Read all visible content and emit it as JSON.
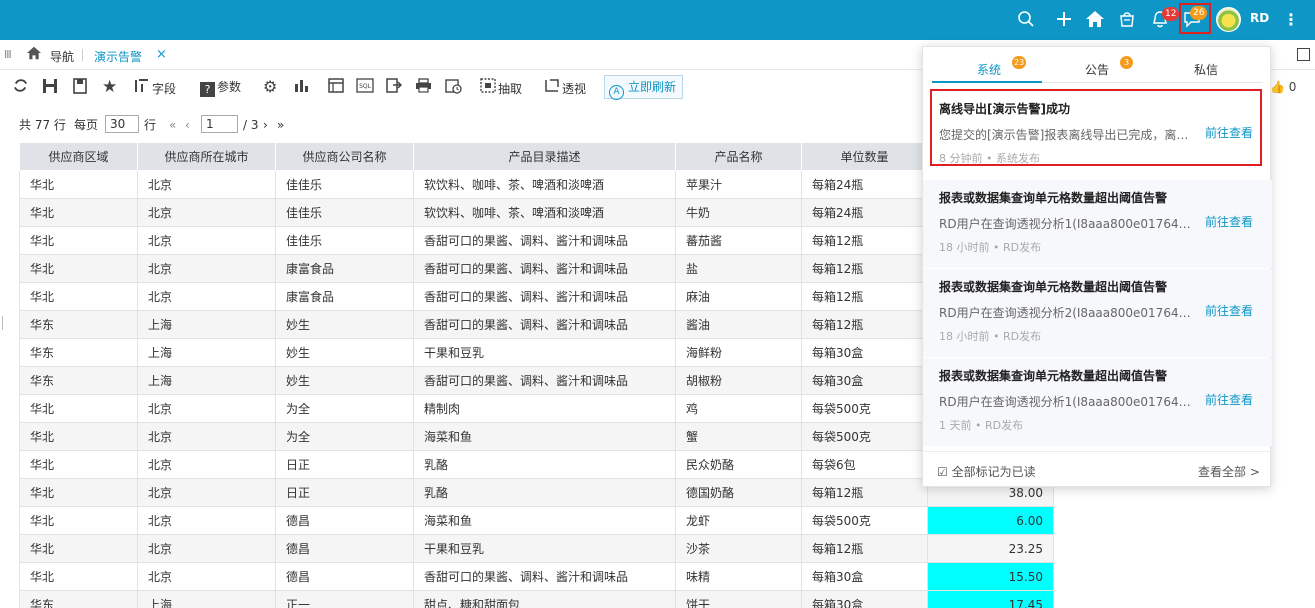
{
  "topbar": {
    "notif_count": "12",
    "msg_count": "26",
    "user": "RD"
  },
  "tabbar": {
    "nav_label": "导航",
    "active_tab": "演示告警"
  },
  "toolbar": {
    "field_label": "字段",
    "param_label": "参数",
    "extract_label": "抽取",
    "pivot_label": "透视",
    "refresh_label": "立即刷新",
    "like_count": "0"
  },
  "pager": {
    "total": "共 77 行",
    "per_page_label": "每页",
    "per_page_value": "30",
    "row_unit": "行",
    "page_value": "1",
    "page_total": "/ 3"
  },
  "table": {
    "headers": [
      "供应商区域",
      "供应商所在城市",
      "供应商公司名称",
      "产品目录描述",
      "产品名称",
      "单位数量",
      ""
    ],
    "rows": [
      {
        "c": [
          "华北",
          "北京",
          "佳佳乐",
          "软饮料、咖啡、茶、啤酒和淡啤酒",
          "苹果汁",
          "每箱24瓶",
          ""
        ],
        "hl": false
      },
      {
        "c": [
          "华北",
          "北京",
          "佳佳乐",
          "软饮料、咖啡、茶、啤酒和淡啤酒",
          "牛奶",
          "每箱24瓶",
          ""
        ],
        "hl": false
      },
      {
        "c": [
          "华北",
          "北京",
          "佳佳乐",
          "香甜可口的果酱、调料、酱汁和调味品",
          "蕃茄酱",
          "每箱12瓶",
          ""
        ],
        "hl": false
      },
      {
        "c": [
          "华北",
          "北京",
          "康富食品",
          "香甜可口的果酱、调料、酱汁和调味品",
          "盐",
          "每箱12瓶",
          ""
        ],
        "hl": false
      },
      {
        "c": [
          "华北",
          "北京",
          "康富食品",
          "香甜可口的果酱、调料、酱汁和调味品",
          "麻油",
          "每箱12瓶",
          ""
        ],
        "hl": false
      },
      {
        "c": [
          "华东",
          "上海",
          "妙生",
          "香甜可口的果酱、调料、酱汁和调味品",
          "酱油",
          "每箱12瓶",
          ""
        ],
        "hl": false
      },
      {
        "c": [
          "华东",
          "上海",
          "妙生",
          "干果和豆乳",
          "海鲜粉",
          "每箱30盒",
          ""
        ],
        "hl": false
      },
      {
        "c": [
          "华东",
          "上海",
          "妙生",
          "香甜可口的果酱、调料、酱汁和调味品",
          "胡椒粉",
          "每箱30盒",
          ""
        ],
        "hl": false
      },
      {
        "c": [
          "华北",
          "北京",
          "为全",
          "精制肉",
          "鸡",
          "每袋500克",
          ""
        ],
        "hl": false
      },
      {
        "c": [
          "华北",
          "北京",
          "为全",
          "海菜和鱼",
          "蟹",
          "每袋500克",
          ""
        ],
        "hl": false
      },
      {
        "c": [
          "华北",
          "北京",
          "日正",
          "乳酪",
          "民众奶酪",
          "每袋6包",
          ""
        ],
        "hl": false
      },
      {
        "c": [
          "华北",
          "北京",
          "日正",
          "乳酪",
          "德国奶酪",
          "每箱12瓶",
          "38.00"
        ],
        "hl": false
      },
      {
        "c": [
          "华北",
          "北京",
          "德昌",
          "海菜和鱼",
          "龙虾",
          "每袋500克",
          "6.00"
        ],
        "hl": true
      },
      {
        "c": [
          "华北",
          "北京",
          "德昌",
          "干果和豆乳",
          "沙茶",
          "每箱12瓶",
          "23.25"
        ],
        "hl": false
      },
      {
        "c": [
          "华北",
          "北京",
          "德昌",
          "香甜可口的果酱、调料、酱汁和调味品",
          "味精",
          "每箱30盒",
          "15.50"
        ],
        "hl": true
      },
      {
        "c": [
          "华东",
          "上海",
          "正一",
          "甜点、糖和甜面包",
          "饼干",
          "每箱30盒",
          "17.45"
        ],
        "hl": true
      }
    ]
  },
  "popup": {
    "tabs": [
      {
        "label": "系统",
        "badge": "23"
      },
      {
        "label": "公告",
        "badge": "3"
      },
      {
        "label": "私信",
        "badge": ""
      }
    ],
    "items": [
      {
        "title": "离线导出[演示告警]成功",
        "body": "您提交的[演示告警]报表离线导出已完成，离线导出文件可在我的导出中查看下载",
        "link": "前往查看",
        "meta": "8 分钟前 • 系统发布"
      },
      {
        "title": "报表或数据集查询单元格数量超出阈值告警",
        "body": "RD用户在查询透视分析1(I8aaa800e0176447a...",
        "link": "前往查看",
        "meta": "18 小时前 • RD发布"
      },
      {
        "title": "报表或数据集查询单元格数量超出阈值告警",
        "body": "RD用户在查询透视分析2(I8aaa800e0176447a...",
        "link": "前往查看",
        "meta": "18 小时前 • RD发布"
      },
      {
        "title": "报表或数据集查询单元格数量超出阈值告警",
        "body": "RD用户在查询透视分析1(I8aaa800e0176447a...",
        "link": "前往查看",
        "meta": "1 天前 • RD发布"
      }
    ],
    "mark_all": "全部标记为已读",
    "view_all": "查看全部 >"
  }
}
